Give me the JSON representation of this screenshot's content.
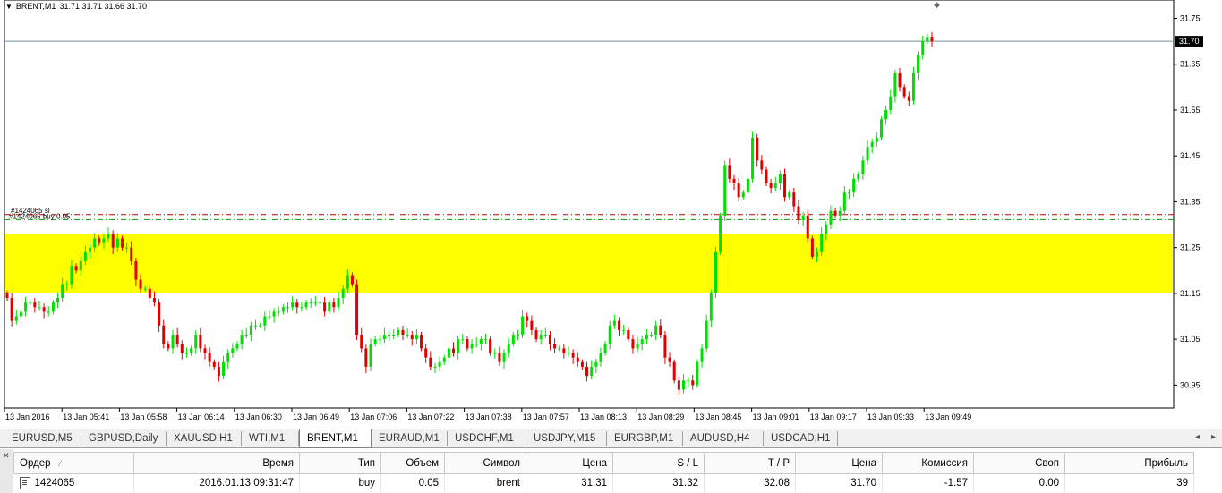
{
  "chart_header": {
    "symbol": "BRENT,M1",
    "ohlc": "31.71 31.71 31.66 31.70"
  },
  "price_axis": {
    "labels": [
      "31.75",
      "31.65",
      "31.55",
      "31.45",
      "31.35",
      "31.25",
      "31.15",
      "31.05",
      "30.95"
    ],
    "current_price": "31.70"
  },
  "time_axis": {
    "labels": [
      "13 Jan 2016",
      "13 Jan 05:41",
      "13 Jan 05:58",
      "13 Jan 06:14",
      "13 Jan 06:30",
      "13 Jan 06:49",
      "13 Jan 07:06",
      "13 Jan 07:22",
      "13 Jan 07:38",
      "13 Jan 07:57",
      "13 Jan 08:13",
      "13 Jan 08:29",
      "13 Jan 08:45",
      "13 Jan 09:01",
      "13 Jan 09:17",
      "13 Jan 09:33",
      "13 Jan 09:49"
    ]
  },
  "order_lines": {
    "sl_label": "#1424065 sl",
    "buy_label": "#1424065 buy 0.05"
  },
  "colors": {
    "bull": "#00e000",
    "bear": "#e00000",
    "zone": "#ffff00",
    "grid": "#000000"
  },
  "chart_data": {
    "type": "candlestick",
    "symbol": "BRENT",
    "timeframe": "M1",
    "y_axis_range": [
      30.9,
      31.79
    ],
    "current_price": 31.7,
    "zone": {
      "low": 31.15,
      "high": 31.28
    },
    "order": {
      "id": 1424065,
      "type": "buy",
      "volume": 0.05,
      "open": 31.31,
      "sl": 31.32,
      "tp": 32.08
    },
    "closes": [
      31.14,
      31.09,
      31.1,
      31.11,
      31.13,
      31.13,
      31.12,
      31.12,
      31.11,
      31.11,
      31.13,
      31.14,
      31.17,
      31.17,
      31.21,
      31.2,
      31.22,
      31.24,
      31.25,
      31.27,
      31.26,
      31.27,
      31.28,
      31.25,
      31.27,
      31.25,
      31.25,
      31.22,
      31.18,
      31.16,
      31.16,
      31.14,
      31.13,
      31.08,
      31.04,
      31.03,
      31.06,
      31.04,
      31.02,
      31.02,
      31.03,
      31.06,
      31.03,
      31.02,
      31.0,
      30.99,
      30.97,
      31.0,
      31.02,
      31.03,
      31.04,
      31.06,
      31.06,
      31.08,
      31.08,
      31.08,
      31.1,
      31.1,
      31.11,
      31.11,
      31.12,
      31.12,
      31.13,
      31.12,
      31.12,
      31.13,
      31.13,
      31.13,
      31.13,
      31.11,
      31.13,
      31.12,
      31.14,
      31.16,
      31.19,
      31.17,
      31.06,
      31.03,
      30.99,
      31.04,
      31.05,
      31.05,
      31.06,
      31.06,
      31.06,
      31.07,
      31.06,
      31.06,
      31.05,
      31.06,
      31.03,
      31.01,
      30.99,
      30.99,
      31.0,
      31.01,
      31.03,
      31.02,
      31.05,
      31.05,
      31.03,
      31.04,
      31.04,
      31.05,
      31.05,
      31.02,
      31.02,
      31.0,
      31.02,
      31.04,
      31.06,
      31.06,
      31.1,
      31.09,
      31.07,
      31.05,
      31.06,
      31.06,
      31.04,
      31.03,
      31.03,
      31.02,
      31.02,
      31.01,
      31.0,
      30.99,
      30.97,
      30.99,
      31.0,
      31.02,
      31.04,
      31.08,
      31.09,
      31.07,
      31.07,
      31.05,
      31.03,
      31.04,
      31.05,
      31.06,
      31.06,
      31.08,
      31.06,
      31.01,
      31.0,
      30.96,
      30.94,
      30.96,
      30.96,
      30.95,
      31.0,
      31.03,
      31.09,
      31.15,
      31.24,
      31.32,
      31.43,
      31.4,
      31.39,
      31.36,
      31.37,
      31.4,
      31.49,
      31.44,
      31.42,
      31.39,
      31.38,
      31.39,
      31.41,
      31.36,
      31.37,
      31.34,
      31.31,
      31.32,
      31.27,
      31.23,
      31.24,
      31.28,
      31.3,
      31.33,
      31.32,
      31.33,
      31.37,
      31.37,
      31.4,
      31.41,
      31.44,
      31.47,
      31.48,
      31.49,
      31.53,
      31.55,
      31.58,
      31.63,
      31.6,
      31.58,
      31.57,
      31.63,
      31.67,
      31.7,
      31.71,
      31.7
    ]
  },
  "tabs": [
    "EURUSD,M5",
    "GBPUSD,Daily",
    "XAUUSD,H1",
    "WTI,M1",
    "BRENT,M1",
    "EURAUD,M1",
    "USDCHF,M1",
    "USDJPY,M15",
    "EURGBP,M1",
    "AUDUSD,H4",
    "USDCAD,H1"
  ],
  "active_tab": "BRENT,M1",
  "terminal": {
    "headers": [
      "Ордер",
      "Время",
      "Тип",
      "Объем",
      "Символ",
      "Цена",
      "S / L",
      "T / P",
      "Цена",
      "Комиссия",
      "Своп",
      "Прибыль"
    ],
    "row": [
      "1424065",
      "2016.01.13 09:31:47",
      "buy",
      "0.05",
      "brent",
      "31.31",
      "31.32",
      "32.08",
      "31.70",
      "-1.57",
      "0.00",
      "39"
    ]
  }
}
